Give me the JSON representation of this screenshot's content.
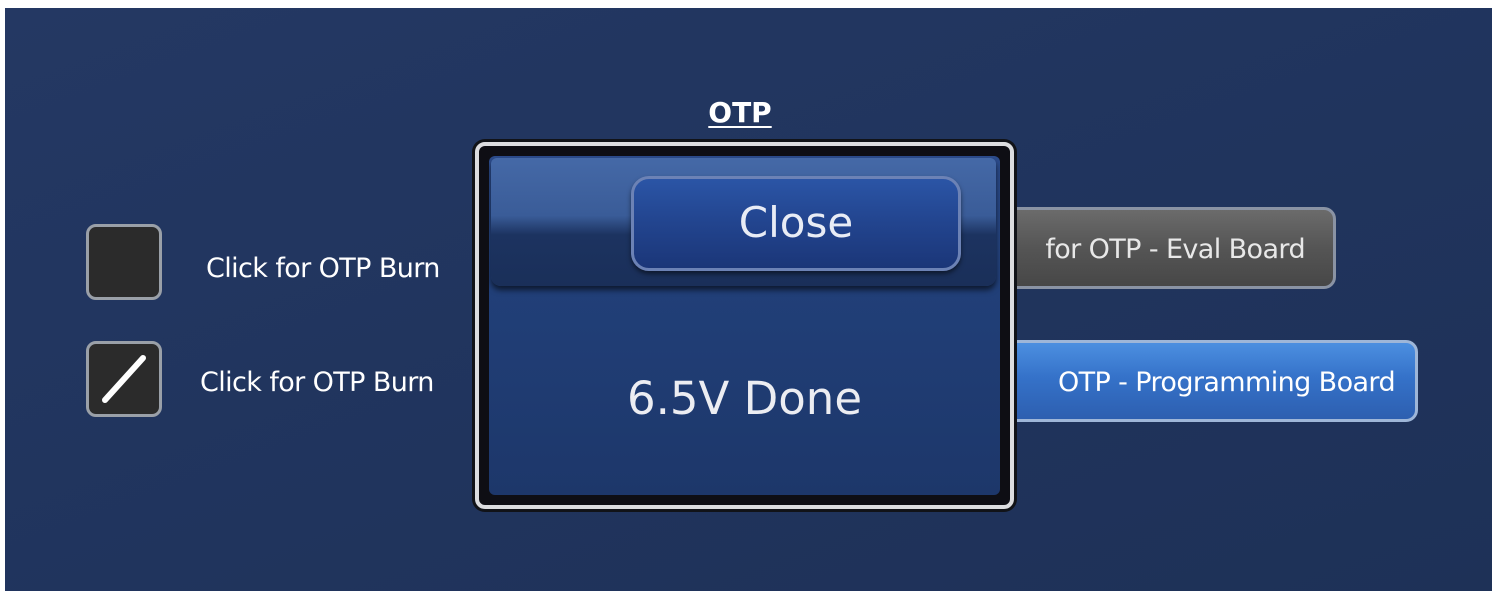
{
  "section": {
    "title": "OTP"
  },
  "options": [
    {
      "checkbox_checked": false,
      "label": "Click for OTP Burn",
      "button_label": "for OTP - Eval Board"
    },
    {
      "checkbox_checked": true,
      "label": "Click for OTP Burn",
      "button_label": "OTP - Programming Board"
    }
  ],
  "dialog": {
    "close_label": "Close",
    "message": "6.5V Done"
  },
  "colors": {
    "background": "#233760",
    "eval_button": "#555555",
    "programming_button": "#3572c9",
    "dialog_body": "#213f78"
  }
}
